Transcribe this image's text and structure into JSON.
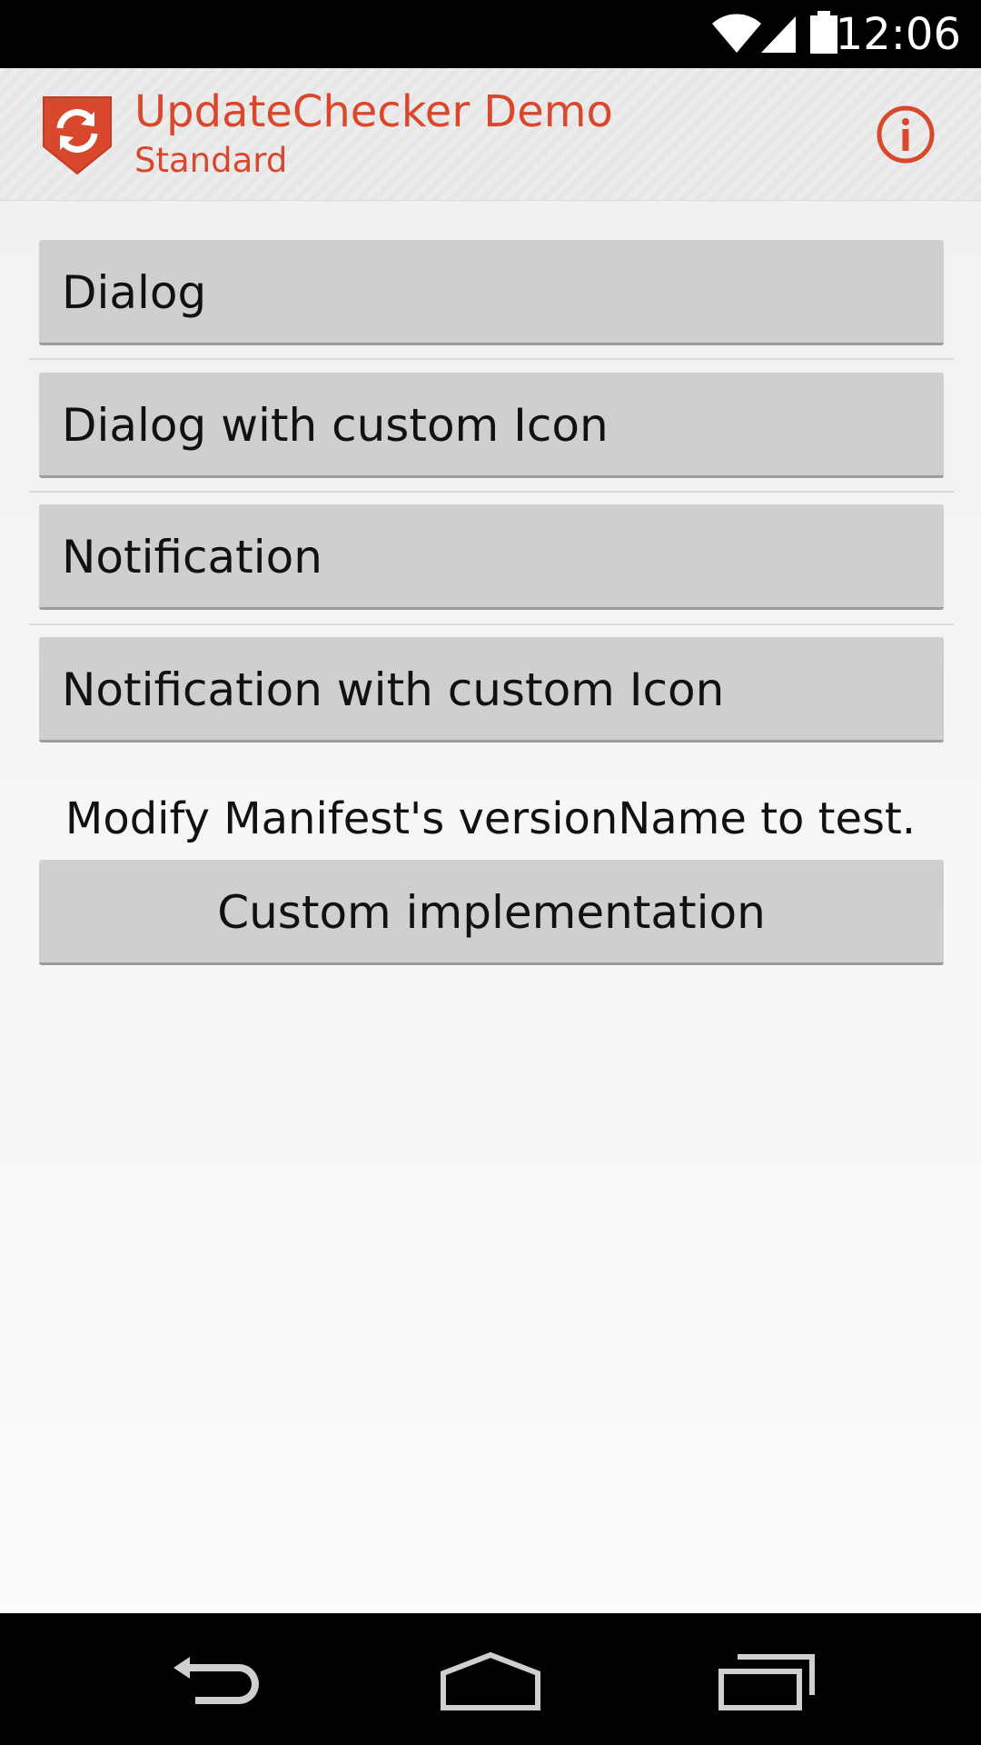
{
  "status_bar": {
    "time": "12:06",
    "icons": [
      "wifi-icon",
      "signal-icon",
      "battery-icon"
    ]
  },
  "action_bar": {
    "title": "UpdateChecker Demo",
    "subtitle": "Standard",
    "logo_icon": "update-refresh-logo",
    "info_icon": "info-icon",
    "accent_color": "#d9472c"
  },
  "main": {
    "buttons": [
      {
        "label": "Dialog"
      },
      {
        "label": "Dialog with custom Icon"
      },
      {
        "label": "Notification"
      },
      {
        "label": "Notification with custom Icon"
      }
    ],
    "hint": "Modify Manifest's versionName to test.",
    "custom_button": "Custom implementation"
  },
  "nav_bar": {
    "icons": [
      "back-icon",
      "home-icon",
      "recents-icon"
    ]
  }
}
